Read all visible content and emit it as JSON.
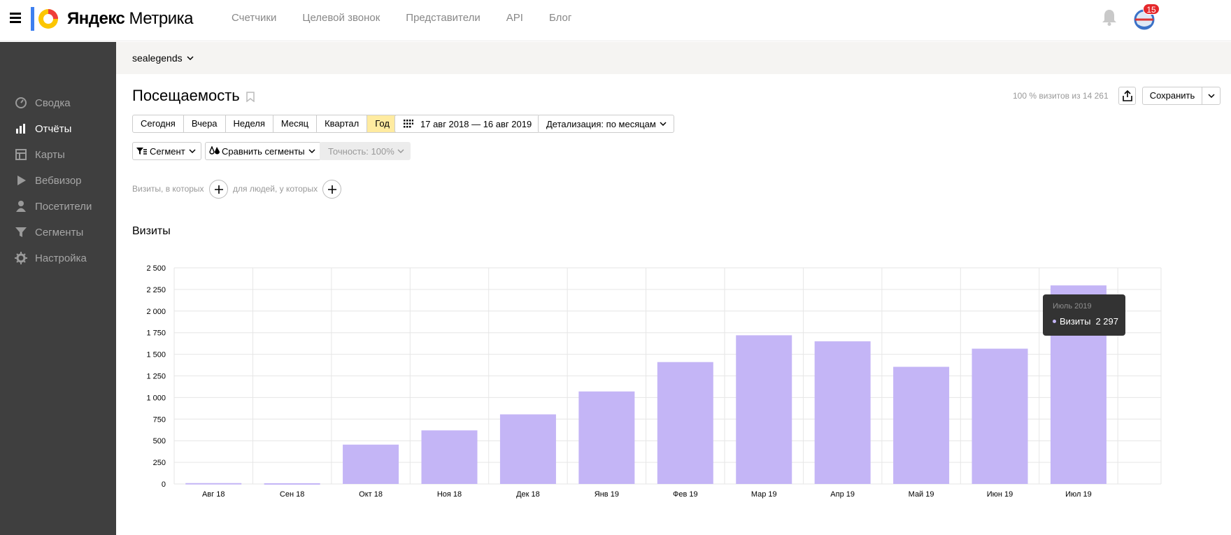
{
  "header": {
    "logo": {
      "ya": "Яндекс",
      "product": "Метрика"
    },
    "nav": [
      "Счетчики",
      "Целевой звонок",
      "Представители",
      "API",
      "Блог"
    ],
    "notifications_count": "15"
  },
  "sidebar": {
    "items": [
      {
        "label": "Сводка",
        "icon": "gauge-icon"
      },
      {
        "label": "Отчёты",
        "icon": "bar-chart-icon",
        "active": true
      },
      {
        "label": "Карты",
        "icon": "map-icon"
      },
      {
        "label": "Вебвизор",
        "icon": "play-icon"
      },
      {
        "label": "Посетители",
        "icon": "user-icon"
      },
      {
        "label": "Сегменты",
        "icon": "filter-icon"
      },
      {
        "label": "Настройка",
        "icon": "gear-icon"
      }
    ]
  },
  "counter": {
    "name": "sealegends"
  },
  "report": {
    "title": "Посещаемость",
    "visits_share": "100 % визитов из 14 261",
    "save_label": "Сохранить",
    "periods": [
      "Сегодня",
      "Вчера",
      "Неделя",
      "Месяц",
      "Квартал",
      "Год"
    ],
    "active_period": "Год",
    "date_range": "17 авг 2018 — 16 авг 2019",
    "detail": "Детализация: по месяцам",
    "segment": "Сегмент",
    "compare": "Сравнить сегменты",
    "accuracy": "Точность: 100%",
    "filter_visits": "Визиты, в которых",
    "filter_people": "для людей, у которых"
  },
  "chart_data": {
    "type": "bar",
    "title": "Визиты",
    "categories": [
      "Авг 18",
      "Сен 18",
      "Окт 18",
      "Ноя 18",
      "Дек 18",
      "Янв 19",
      "Фев 19",
      "Мар 19",
      "Апр 19",
      "Май 19",
      "Июн 19",
      "Июл 19"
    ],
    "series": [
      {
        "name": "Визиты",
        "values": [
          10,
          8,
          455,
          620,
          805,
          1070,
          1410,
          1720,
          1650,
          1355,
          1565,
          2297
        ]
      }
    ],
    "ylim": [
      0,
      2500
    ],
    "yticks": [
      "0",
      "250",
      "500",
      "750",
      "1 000",
      "1 250",
      "1 500",
      "1 750",
      "2 000",
      "2 250",
      "2 500"
    ],
    "grid": true,
    "bar_color": "#c4b5f6"
  },
  "tooltip": {
    "month": "Июль 2019",
    "series": "Визиты",
    "value": "2 297"
  }
}
